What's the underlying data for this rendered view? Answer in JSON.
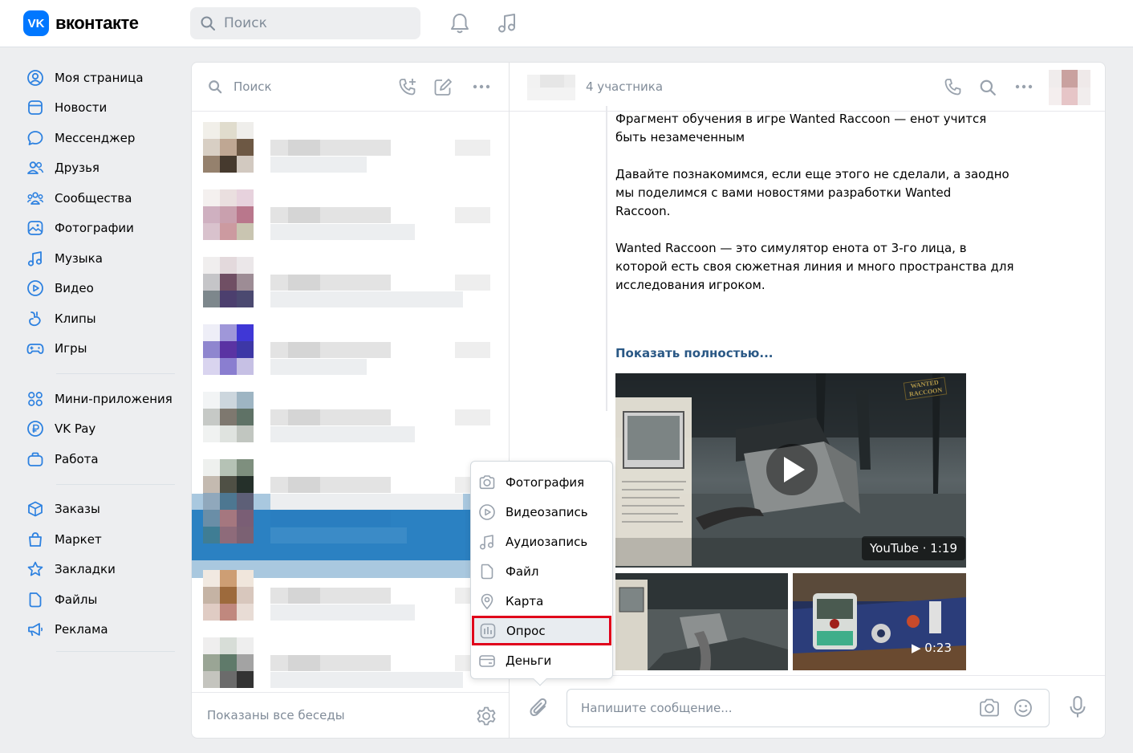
{
  "topbar": {
    "logo_mark": "VK",
    "logo_text": "вконтакте",
    "search_placeholder": "Поиск"
  },
  "leftnav": {
    "group1": [
      {
        "label": "Моя страница",
        "icon": "user-circle-icon"
      },
      {
        "label": "Новости",
        "icon": "news-icon"
      },
      {
        "label": "Мессенджер",
        "icon": "message-icon"
      },
      {
        "label": "Друзья",
        "icon": "friends-icon"
      },
      {
        "label": "Сообщества",
        "icon": "communities-icon"
      },
      {
        "label": "Фотографии",
        "icon": "photo-icon"
      },
      {
        "label": "Музыка",
        "icon": "music-icon"
      },
      {
        "label": "Видео",
        "icon": "video-icon"
      },
      {
        "label": "Клипы",
        "icon": "clips-icon"
      },
      {
        "label": "Игры",
        "icon": "gamepad-icon"
      }
    ],
    "group2": [
      {
        "label": "Мини-приложения",
        "icon": "apps-icon"
      },
      {
        "label": "VK Pay",
        "icon": "vkpay-icon"
      },
      {
        "label": "Работа",
        "icon": "briefcase-icon"
      }
    ],
    "group3": [
      {
        "label": "Заказы",
        "icon": "box-icon"
      },
      {
        "label": "Маркет",
        "icon": "bag-icon"
      },
      {
        "label": "Закладки",
        "icon": "star-icon"
      },
      {
        "label": "Файлы",
        "icon": "file-icon"
      },
      {
        "label": "Реклама",
        "icon": "megaphone-icon"
      }
    ]
  },
  "dialogs": {
    "search_placeholder": "Поиск",
    "footer_text": "Показаны все беседы"
  },
  "chat": {
    "members": "4 участника",
    "message_lines": [
      "Фрагмент обучения в игре Wanted Raccoon — енот учится",
      "быть незамеченным",
      "",
      "Давайте познакомимся, если еще этого не сделали, а заодно",
      "мы поделимся с вами новостями разработки Wanted",
      "Raccoon.",
      "",
      "Wanted Raccoon — это симулятор енота от 3-го лица, в",
      "которой есть своя сюжетная линия и много пространства для",
      "исследования игроком."
    ],
    "show_more": "Показать полностью...",
    "video_badge": "YouTube · 1:19",
    "video_watermark": "WANTED RACCOON",
    "thumb2_duration": "▶ 0:23",
    "input_placeholder": "Напишите сообщение..."
  },
  "attach_menu": {
    "items": [
      {
        "label": "Фотография",
        "icon": "camera-icon"
      },
      {
        "label": "Видеозапись",
        "icon": "play-circle-icon"
      },
      {
        "label": "Аудиозапись",
        "icon": "music-note-icon"
      },
      {
        "label": "Файл",
        "icon": "document-icon"
      },
      {
        "label": "Карта",
        "icon": "map-pin-icon"
      },
      {
        "label": "Опрос",
        "icon": "poll-icon"
      },
      {
        "label": "Деньги",
        "icon": "money-icon"
      }
    ],
    "highlighted": "Опрос"
  }
}
